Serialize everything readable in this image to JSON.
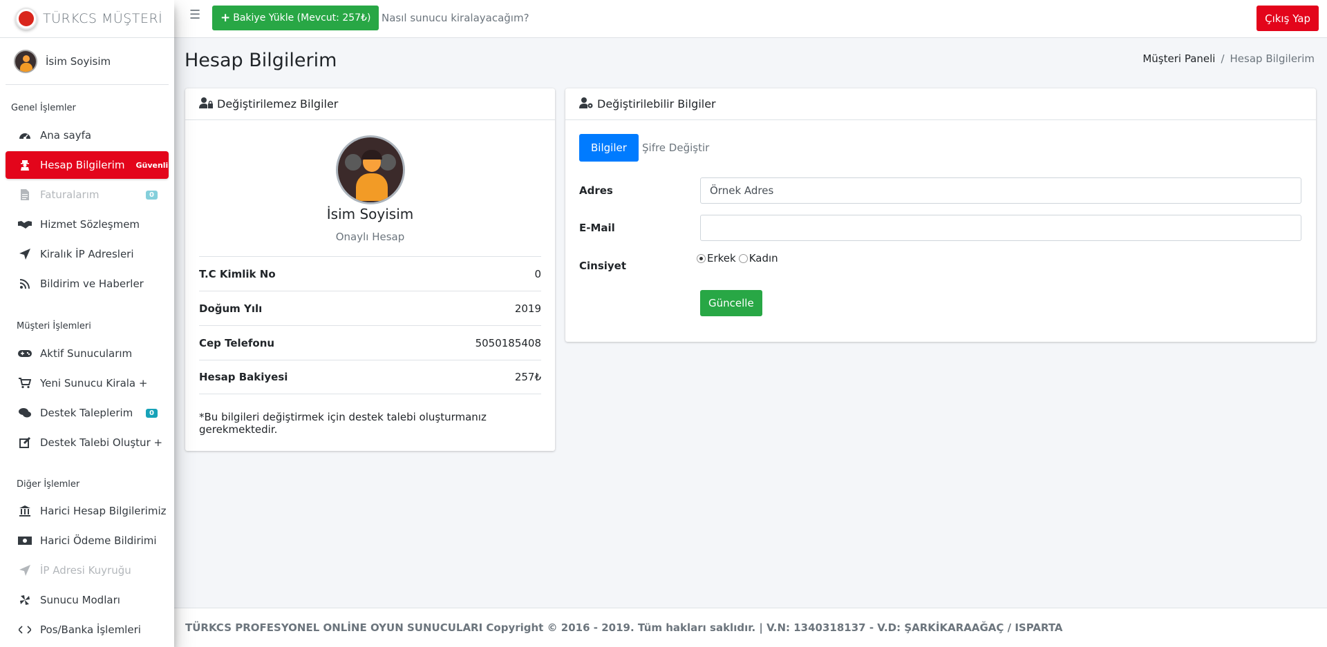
{
  "brand": {
    "name": "TÜRKCS MÜŞTERİ"
  },
  "user": {
    "name": "İsim Soyisim"
  },
  "topbar": {
    "load_balance": "Bakiye Yükle (Mevcut: 257₺)",
    "help_link": "Nasıl sunucu kiralayacağım?",
    "logout": "Çıkış Yap"
  },
  "sidebar": {
    "sections": [
      "Genel İşlemler",
      "Müşteri İşlemleri",
      "Diğer İşlemler"
    ],
    "items": [
      {
        "label": "Ana sayfa",
        "icon": "dashboard-icon"
      },
      {
        "label": "Hesap Bilgilerim",
        "icon": "user-secret-icon",
        "badge": "Güvenli"
      },
      {
        "label": "Faturalarım",
        "icon": "invoice-icon",
        "badge": "0"
      },
      {
        "label": "Hizmet Sözleşmem",
        "icon": "handshake-icon"
      },
      {
        "label": "Kiralık İP Adresleri",
        "icon": "paper-plane-icon"
      },
      {
        "label": "Bildirim ve Haberler",
        "icon": "rss-icon"
      },
      {
        "label": "Aktif Sunucularım",
        "icon": "gamepad-icon"
      },
      {
        "label": "Yeni Sunucu Kirala +",
        "icon": "cart-icon"
      },
      {
        "label": "Destek Taleplerim",
        "icon": "comments-icon",
        "badge": "0"
      },
      {
        "label": "Destek Talebi Oluştur +",
        "icon": "edit-icon"
      },
      {
        "label": "Harici Hesap Bilgilerimiz",
        "icon": "bank-icon"
      },
      {
        "label": "Harici Ödeme Bildirimi",
        "icon": "money-icon"
      },
      {
        "label": "İP Adresi Kuyruğu",
        "icon": "paper-plane-icon"
      },
      {
        "label": "Sunucu Modları",
        "icon": "fan-icon"
      },
      {
        "label": "Pos/Banka İşlemleri",
        "icon": "code-icon"
      }
    ]
  },
  "page": {
    "title": "Hesap Bilgilerim",
    "breadcrumb": [
      "Müşteri Paneli",
      "Hesap Bilgilerim"
    ]
  },
  "left_card": {
    "title": "Değiştirilemez Bilgiler",
    "name": "İsim Soyisim",
    "status": "Onaylı Hesap",
    "rows": [
      {
        "label": "T.C Kimlik No",
        "value": "0"
      },
      {
        "label": "Doğum Yılı",
        "value": "2019"
      },
      {
        "label": "Cep Telefonu",
        "value": "5050185408"
      },
      {
        "label": "Hesap Bakiyesi",
        "value": "257₺"
      }
    ],
    "note": "*Bu bilgileri değiştirmek için destek talebi oluşturmanız gerekmektedir."
  },
  "right_card": {
    "title": "Değiştirilebilir Bilgiler",
    "tabs": [
      "Bilgiler",
      "Şifre Değiştir"
    ],
    "address_label": "Adres",
    "address_value": "Örnek Adres",
    "email_label": "E-Mail",
    "email_value": "",
    "gender_label": "Cinsiyet",
    "gender_options": [
      "Erkek",
      "Kadın"
    ],
    "update_button": "Güncelle"
  },
  "footer": {
    "text": "TÜRKCS PROFESYONEL ONLİNE OYUN SUNUCULARI Copyright © 2016 - 2019. Tüm hakları saklıdır. | V.N: 1340318137 - V.D: ŞARKİKARAAĞAÇ / ISPARTA"
  },
  "colors": {
    "accent": "#e3051b",
    "success": "#28a745",
    "primary": "#007bff",
    "info": "#17a2b8"
  }
}
